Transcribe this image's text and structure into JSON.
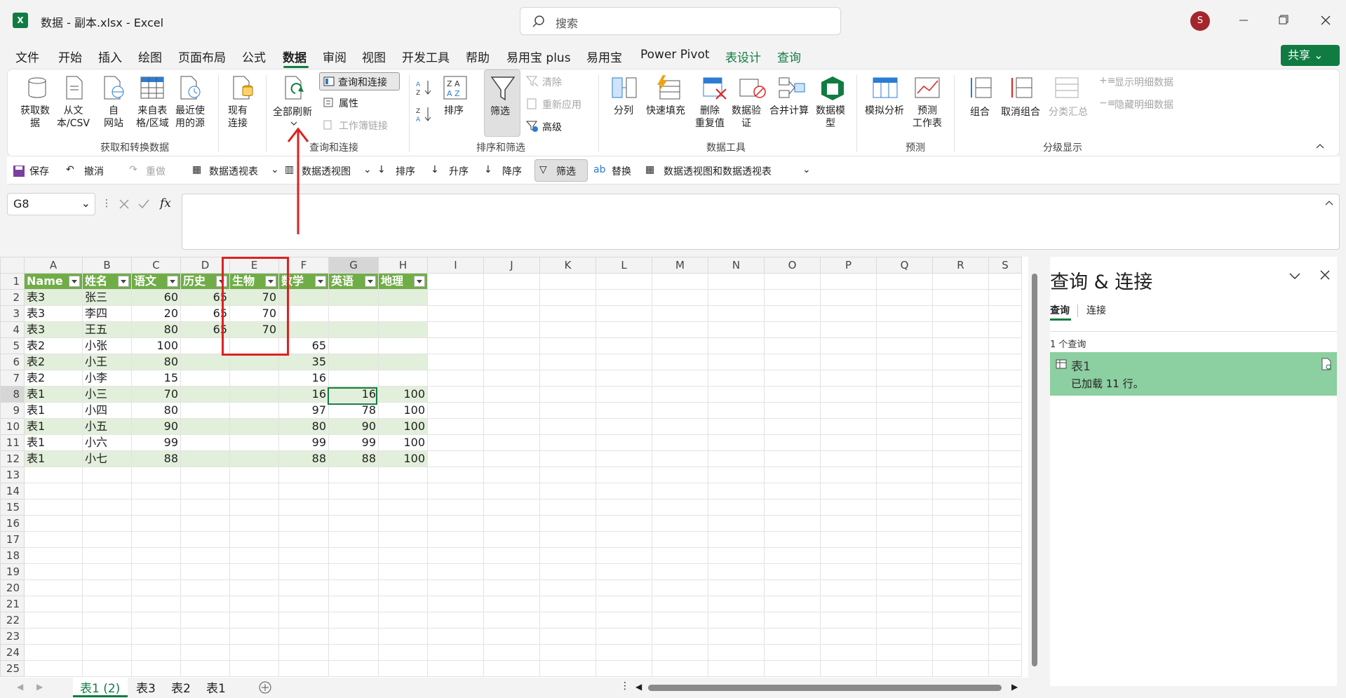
{
  "titlebar": {
    "app_icon": "excel-icon",
    "app_letter": "X",
    "title": "数据 - 副本.xlsx  -  Excel",
    "search_placeholder": "搜索",
    "avatar": "S"
  },
  "menu": {
    "items": [
      "文件",
      "开始",
      "插入",
      "绘图",
      "页面布局",
      "公式",
      "数据",
      "审阅",
      "视图",
      "开发工具",
      "帮助",
      "易用宝 plus",
      "易用宝",
      "Power Pivot",
      "表设计",
      "查询"
    ],
    "active": "数据",
    "share": "共享"
  },
  "ribbon": {
    "get_data": "获取数\n据",
    "from_csv": "从文\n本/CSV",
    "from_web": "自\n网站",
    "from_table": "来自表\n格/区域",
    "recent": "最近使\n用的源",
    "existing": "现有\n连接",
    "group1": "获取和转换数据",
    "refresh_all": "全部刷新",
    "query_conn": "查询和连接",
    "properties": "属性",
    "workbook_links": "工作簿链接",
    "group2": "查询和连接",
    "sort": "排序",
    "filter": "筛选",
    "clear": "清除",
    "reapply": "重新应用",
    "advanced": "高级",
    "group3": "排序和筛选",
    "split": "分列",
    "flash_fill": "快速填充",
    "remove_dup": "删除\n重复值",
    "validation": "数据验\n证",
    "consolidate": "合并计算",
    "data_model": "数据模\n型",
    "group4": "数据工具",
    "what_if": "模拟分析",
    "forecast": "预测\n工作表",
    "group5": "预测",
    "group_btn": "组合",
    "ungroup": "取消组合",
    "subtotal": "分类汇总",
    "show_detail": "显示明细数据",
    "hide_detail": "隐藏明细数据",
    "group6": "分级显示"
  },
  "qat": {
    "save": "保存",
    "undo": "撤消",
    "redo": "重做",
    "pivot": "数据透视表",
    "pivot_chart": "数据透视图",
    "sort": "排序",
    "asc": "升序",
    "desc": "降序",
    "filter": "筛选",
    "replace": "替换",
    "pivot_both": "数据透视图和数据透视表"
  },
  "formula": {
    "cell": "G8",
    "fx": "fx",
    "content": ""
  },
  "sheet": {
    "columns": [
      "A",
      "B",
      "C",
      "D",
      "E",
      "F",
      "G",
      "H",
      "I",
      "J",
      "K",
      "L",
      "M",
      "N",
      "O",
      "P",
      "Q",
      "R",
      "S"
    ],
    "headers": [
      "Name",
      "姓名",
      "语文",
      "历史",
      "生物",
      "数学",
      "英语",
      "地理"
    ],
    "rows": [
      [
        "表3",
        "张三",
        "60",
        "65",
        "70",
        "",
        "",
        ""
      ],
      [
        "表3",
        "李四",
        "20",
        "65",
        "70",
        "",
        "",
        ""
      ],
      [
        "表3",
        "王五",
        "80",
        "65",
        "70",
        "",
        "",
        ""
      ],
      [
        "表2",
        "小张",
        "100",
        "",
        "",
        "65",
        "",
        ""
      ],
      [
        "表2",
        "小王",
        "80",
        "",
        "",
        "35",
        "",
        ""
      ],
      [
        "表2",
        "小李",
        "15",
        "",
        "",
        "16",
        "",
        ""
      ],
      [
        "表1",
        "小三",
        "70",
        "",
        "",
        "16",
        "16",
        "100"
      ],
      [
        "表1",
        "小四",
        "80",
        "",
        "",
        "97",
        "78",
        "100"
      ],
      [
        "表1",
        "小五",
        "90",
        "",
        "",
        "80",
        "90",
        "100"
      ],
      [
        "表1",
        "小六",
        "99",
        "",
        "",
        "99",
        "99",
        "100"
      ],
      [
        "表1",
        "小七",
        "88",
        "",
        "",
        "88",
        "88",
        "100"
      ]
    ],
    "total_rows": 25,
    "tabs": [
      "表1 (2)",
      "表3",
      "表2",
      "表1"
    ],
    "active_tab": "表1 (2)"
  },
  "pane": {
    "title": "查询 & 连接",
    "tab_queries": "查询",
    "tab_connections": "连接",
    "count": "1 个查询",
    "query_name": "表1",
    "query_status": "已加载 11 行。"
  },
  "colors": {
    "accent": "#107c41",
    "table_header": "#70ad47",
    "band": "#e2efda",
    "annotation": "#e02020"
  }
}
